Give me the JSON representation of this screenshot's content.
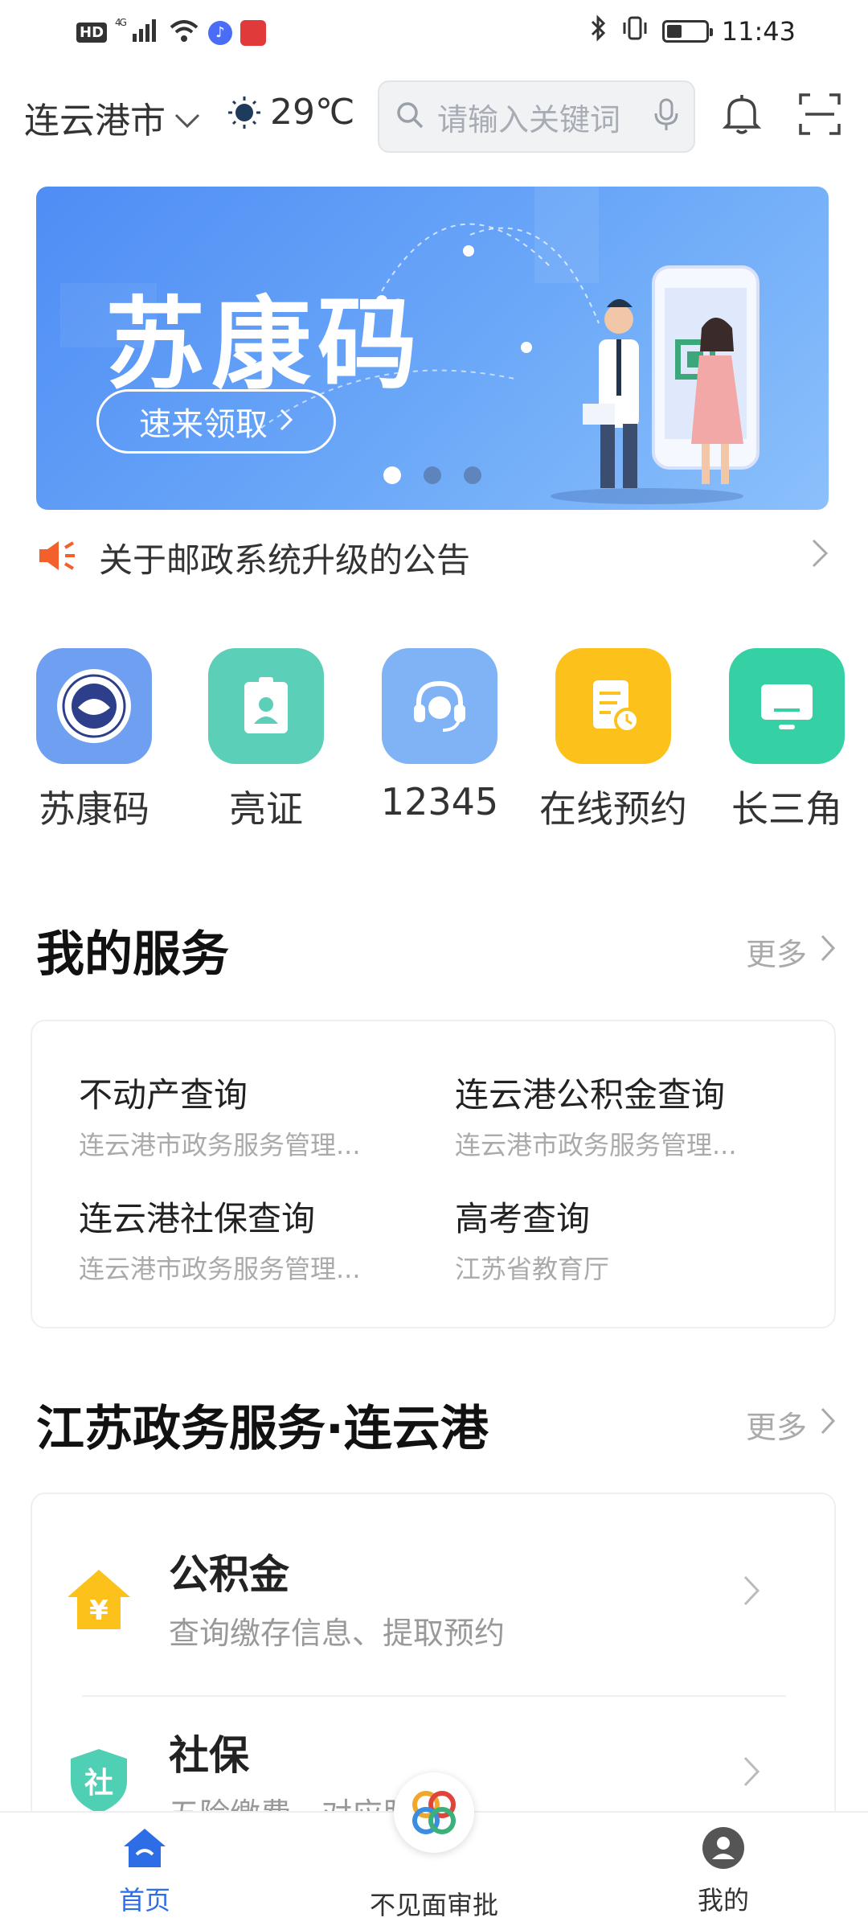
{
  "status_bar": {
    "hd": "HD",
    "network": "4G",
    "time": "11:43",
    "battery_level": 0.4
  },
  "topbar": {
    "city": "连云港市",
    "temperature": "29℃",
    "search_placeholder": "请输入关键词"
  },
  "banner": {
    "title": "苏康码",
    "button_label": "速来领取",
    "page_count": 3,
    "active_page": 1
  },
  "notice": {
    "text": "关于邮政系统升级的公告"
  },
  "quick_actions": [
    {
      "label": "苏康码",
      "icon": "emblem-icon",
      "color": "#6f9ff0"
    },
    {
      "label": "亮证",
      "icon": "id-badge-icon",
      "color": "#5ccfb8"
    },
    {
      "label": "12345",
      "icon": "headset-icon",
      "color": "#7fb3f5"
    },
    {
      "label": "在线预约",
      "icon": "calendar-doc-icon",
      "color": "#fcc21b"
    },
    {
      "label": "长三角",
      "icon": "monitor-icon",
      "color": "#35d1a5"
    }
  ],
  "my_services": {
    "title": "我的服务",
    "more": "更多",
    "items": [
      {
        "name": "不动产查询",
        "org": "连云港市政务服务管理..."
      },
      {
        "name": "连云港公积金查询",
        "org": "连云港市政务服务管理..."
      },
      {
        "name": "连云港社保查询",
        "org": "连云港市政务服务管理..."
      },
      {
        "name": "高考查询",
        "org": "江苏省教育厅"
      }
    ]
  },
  "jiangsu": {
    "title": "江苏政务服务·连云港",
    "more": "更多",
    "items": [
      {
        "title": "公积金",
        "desc": "查询缴存信息、提取预约",
        "icon": "house-yuan-icon",
        "color": "#fcc21b"
      },
      {
        "title": "社保",
        "desc": "五险缴费、对应服务",
        "icon_text": "社",
        "icon": "shield-icon",
        "color": "#4fcfb4"
      }
    ]
  },
  "bottom_nav": {
    "home": "首页",
    "approval": "不见面审批",
    "mine": "我的"
  }
}
